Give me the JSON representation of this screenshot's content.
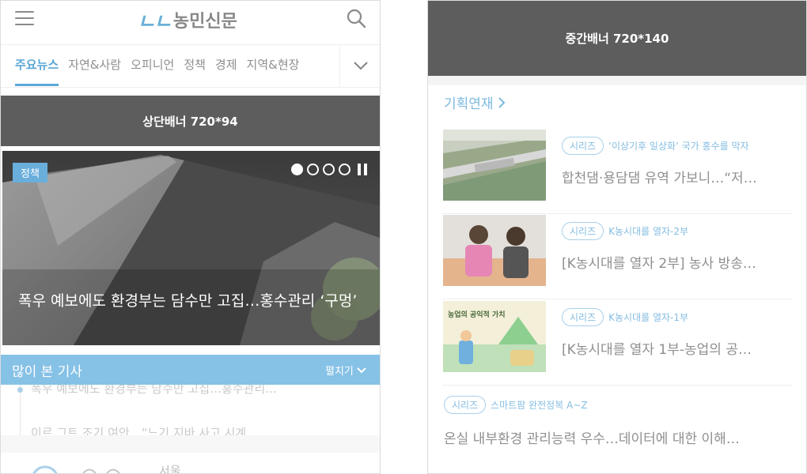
{
  "left": {
    "logo": {
      "mark": "ㄴㄴ",
      "text": "농민신문"
    },
    "nav": {
      "items": [
        "주요뉴스",
        "자연&사람",
        "오피니언",
        "정책",
        "경제",
        "지역&현장"
      ]
    },
    "top_banner": "상단배너 720*94",
    "hero": {
      "tag": "정책",
      "title": "폭우 예보에도 환경부는 담수만 고집…홍수관리 ‘구멍’",
      "slide_current": 1,
      "slide_total": 4
    },
    "most_read": {
      "title": "많이 본 기사",
      "expand_label": "펼치기",
      "items": [
        "폭우 예보에도 환경부는 담수만 고집…홍수관리...",
        "이르 그트 조기 여안…“느기 지바 사고 시계..."
      ]
    },
    "weather": {
      "city": "서울"
    }
  },
  "right": {
    "mid_banner": "중간배너 720*140",
    "series_heading": "기획연재",
    "series": [
      {
        "badge": "시리즈",
        "subtitle": "‘이상기후 일상화’ 국가 홍수를 막자",
        "title": "합천댐·용담댐 유역 가보니…“저…"
      },
      {
        "badge": "시리즈",
        "subtitle": "K농시대를 열자-2부",
        "title": "[K농시대를 열자 2부] 농사 방송…"
      },
      {
        "badge": "시리즈",
        "subtitle": "K농시대를 열자-1부",
        "title": "[K농시대를 열자 1부-농업의 공…",
        "thumb_text": "농업의 공익적 가치"
      },
      {
        "badge": "시리즈",
        "subtitle": "스마트팜 완전정복 A~Z",
        "title": "온실 내부환경 관리능력 우수…데이터에 대한 이해…"
      }
    ]
  },
  "colors": {
    "accent": "#5aa7d6",
    "banner": "#5d5d5d",
    "most_read_bar": "#86c1e6",
    "series": "#84bde2"
  }
}
